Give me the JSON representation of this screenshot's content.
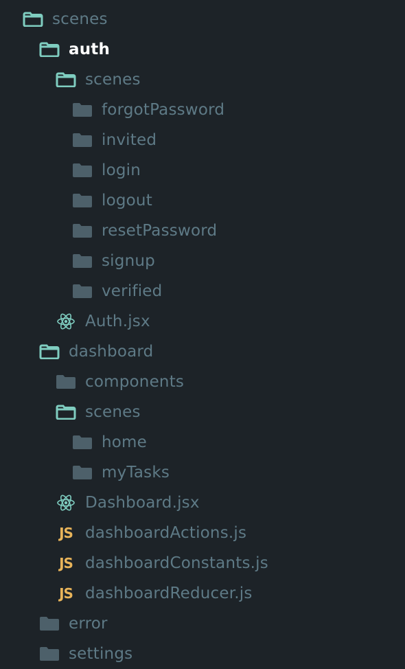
{
  "colors": {
    "background": "#1d2328",
    "text": "#5e7a86",
    "active_text": "#ffffff",
    "open_folder": "#7fcdc0",
    "closed_folder": "#4d606a",
    "react": "#7fcdc0",
    "js": "#e8b45a"
  },
  "tree": [
    {
      "label": "scenes",
      "depth": 0,
      "icon": "folder-open-icon"
    },
    {
      "label": "auth",
      "depth": 1,
      "icon": "folder-open-icon",
      "active": true
    },
    {
      "label": "scenes",
      "depth": 2,
      "icon": "folder-open-icon"
    },
    {
      "label": "forgotPassword",
      "depth": 3,
      "icon": "folder-closed-icon"
    },
    {
      "label": "invited",
      "depth": 3,
      "icon": "folder-closed-icon"
    },
    {
      "label": "login",
      "depth": 3,
      "icon": "folder-closed-icon"
    },
    {
      "label": "logout",
      "depth": 3,
      "icon": "folder-closed-icon"
    },
    {
      "label": "resetPassword",
      "depth": 3,
      "icon": "folder-closed-icon"
    },
    {
      "label": "signup",
      "depth": 3,
      "icon": "folder-closed-icon"
    },
    {
      "label": "verified",
      "depth": 3,
      "icon": "folder-closed-icon"
    },
    {
      "label": "Auth.jsx",
      "depth": 2,
      "icon": "react-icon"
    },
    {
      "label": "dashboard",
      "depth": 1,
      "icon": "folder-open-icon"
    },
    {
      "label": "components",
      "depth": 2,
      "icon": "folder-closed-icon"
    },
    {
      "label": "scenes",
      "depth": 2,
      "icon": "folder-open-icon"
    },
    {
      "label": "home",
      "depth": 3,
      "icon": "folder-closed-icon"
    },
    {
      "label": "myTasks",
      "depth": 3,
      "icon": "folder-closed-icon"
    },
    {
      "label": "Dashboard.jsx",
      "depth": 2,
      "icon": "react-icon"
    },
    {
      "label": "dashboardActions.js",
      "depth": 2,
      "icon": "js-icon",
      "icon_text": "JS"
    },
    {
      "label": "dashboardConstants.js",
      "depth": 2,
      "icon": "js-icon",
      "icon_text": "JS"
    },
    {
      "label": "dashboardReducer.js",
      "depth": 2,
      "icon": "js-icon",
      "icon_text": "JS"
    },
    {
      "label": "error",
      "depth": 1,
      "icon": "folder-closed-icon"
    },
    {
      "label": "settings",
      "depth": 1,
      "icon": "folder-closed-icon"
    }
  ]
}
